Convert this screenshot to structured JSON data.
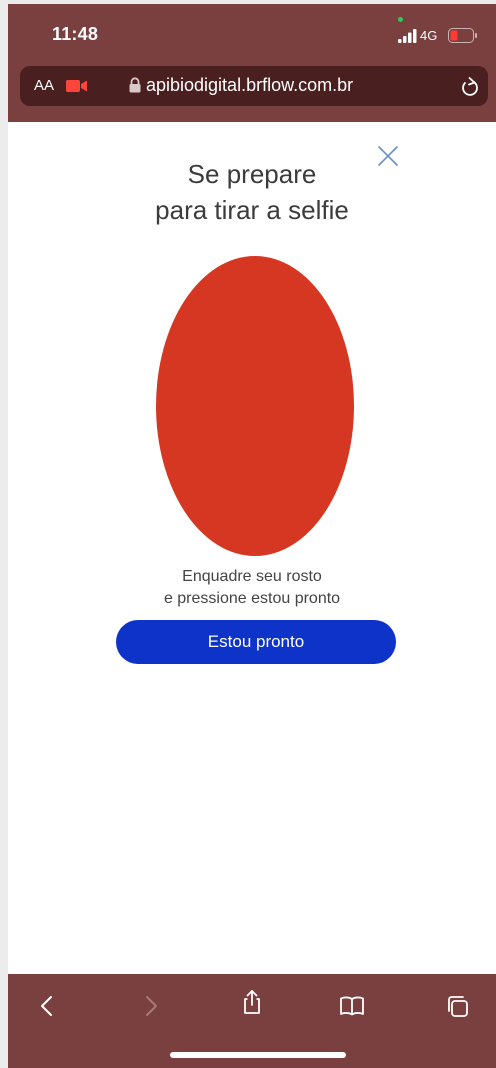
{
  "status_bar": {
    "time": "11:48",
    "network": "4G"
  },
  "browser": {
    "aa_label": "AA",
    "url": "apibiodigital.brflow.com.br"
  },
  "page": {
    "title_line1": "Se prepare",
    "title_line2": "para tirar a selfie",
    "instruction_line1": "Enquadre seu rosto",
    "instruction_line2": "e pressione estou pronto",
    "ready_button_label": "Estou pronto"
  },
  "toolbar": {
    "items": [
      "back-icon",
      "forward-icon",
      "share-icon",
      "bookmarks-icon",
      "tabs-icon"
    ]
  },
  "colors": {
    "chrome": "#7a3f3f",
    "url_bar": "#4a1f20",
    "oval": "#d53723",
    "button": "#0d33c9",
    "close_icon": "#6a8fc7"
  }
}
